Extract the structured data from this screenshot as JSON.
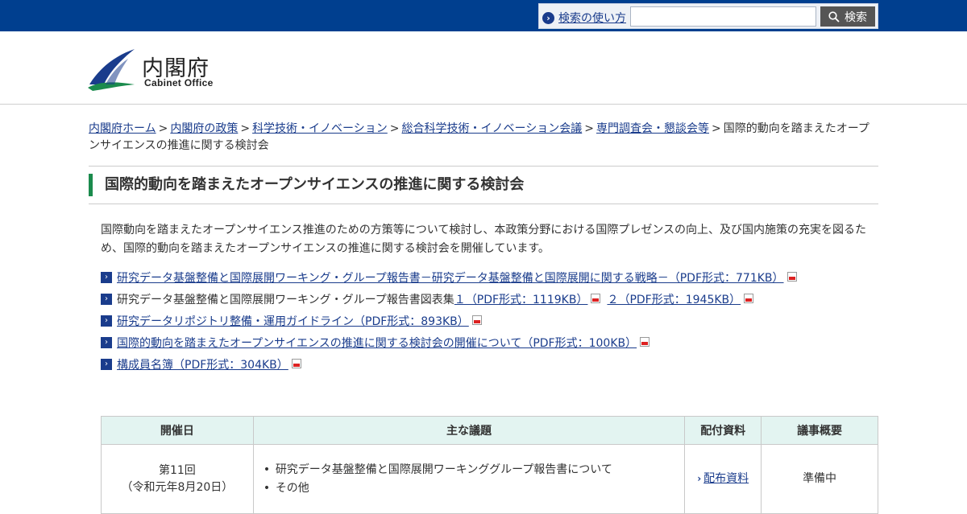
{
  "topbar": {
    "help_label": "検索の使い方",
    "search_placeholder": "",
    "search_button": "検索"
  },
  "header": {
    "logo_title": "内閣府",
    "logo_sub": "Cabinet Office"
  },
  "breadcrumb": {
    "links": [
      "内閣府ホーム",
      "内閣府の政策",
      "科学技術・イノベーション",
      "総合科学技術・イノベーション会議",
      "専門調査会・懇談会等"
    ],
    "current": "国際的動向を踏まえたオープンサイエンスの推進に関する検討会"
  },
  "page": {
    "title": "国際的動向を踏まえたオープンサイエンスの推進に関する検討会",
    "intro": "国際動向を踏まえたオープンサイエンス推進のための方策等について検討し、本政策分野における国際プレゼンスの向上、及び国内施策の充実を図るため、国際的動向を踏まえたオープンサイエンスの推進に関する検討会を開催しています。"
  },
  "documents": [
    {
      "text": "研究データ基盤整備と国際展開ワーキング・グループ報告書－研究データ基盤整備と国際展開に関する戦略－（PDF形式：771KB）"
    },
    {
      "prefix": "研究データ基盤整備と国際展開ワーキング・グループ報告書図表集",
      "link1": "１（PDF形式：1119KB）",
      "link2": "２（PDF形式：1945KB）"
    },
    {
      "text": "研究データリポジトリ整備・運用ガイドライン（PDF形式：893KB）"
    },
    {
      "text": "国際的動向を踏まえたオープンサイエンスの推進に関する検討会の開催について（PDF形式：100KB）"
    },
    {
      "text": "構成員名簿（PDF形式：304KB）"
    }
  ],
  "table": {
    "headers": [
      "開催日",
      "主な議題",
      "配付資料",
      "議事概要"
    ],
    "rows": [
      {
        "date_line1": "第11回",
        "date_line2": "（令和元年8月20日）",
        "topics": [
          "研究データ基盤整備と国際展開ワーキンググループ報告書について",
          "その他"
        ],
        "materials": "配布資料",
        "summary": "準備中"
      }
    ]
  },
  "colors": {
    "topbar": "#003f8f",
    "title_accent": "#1b8b4d",
    "table_header": "#e3f4f1",
    "link": "#1a3c8c"
  }
}
